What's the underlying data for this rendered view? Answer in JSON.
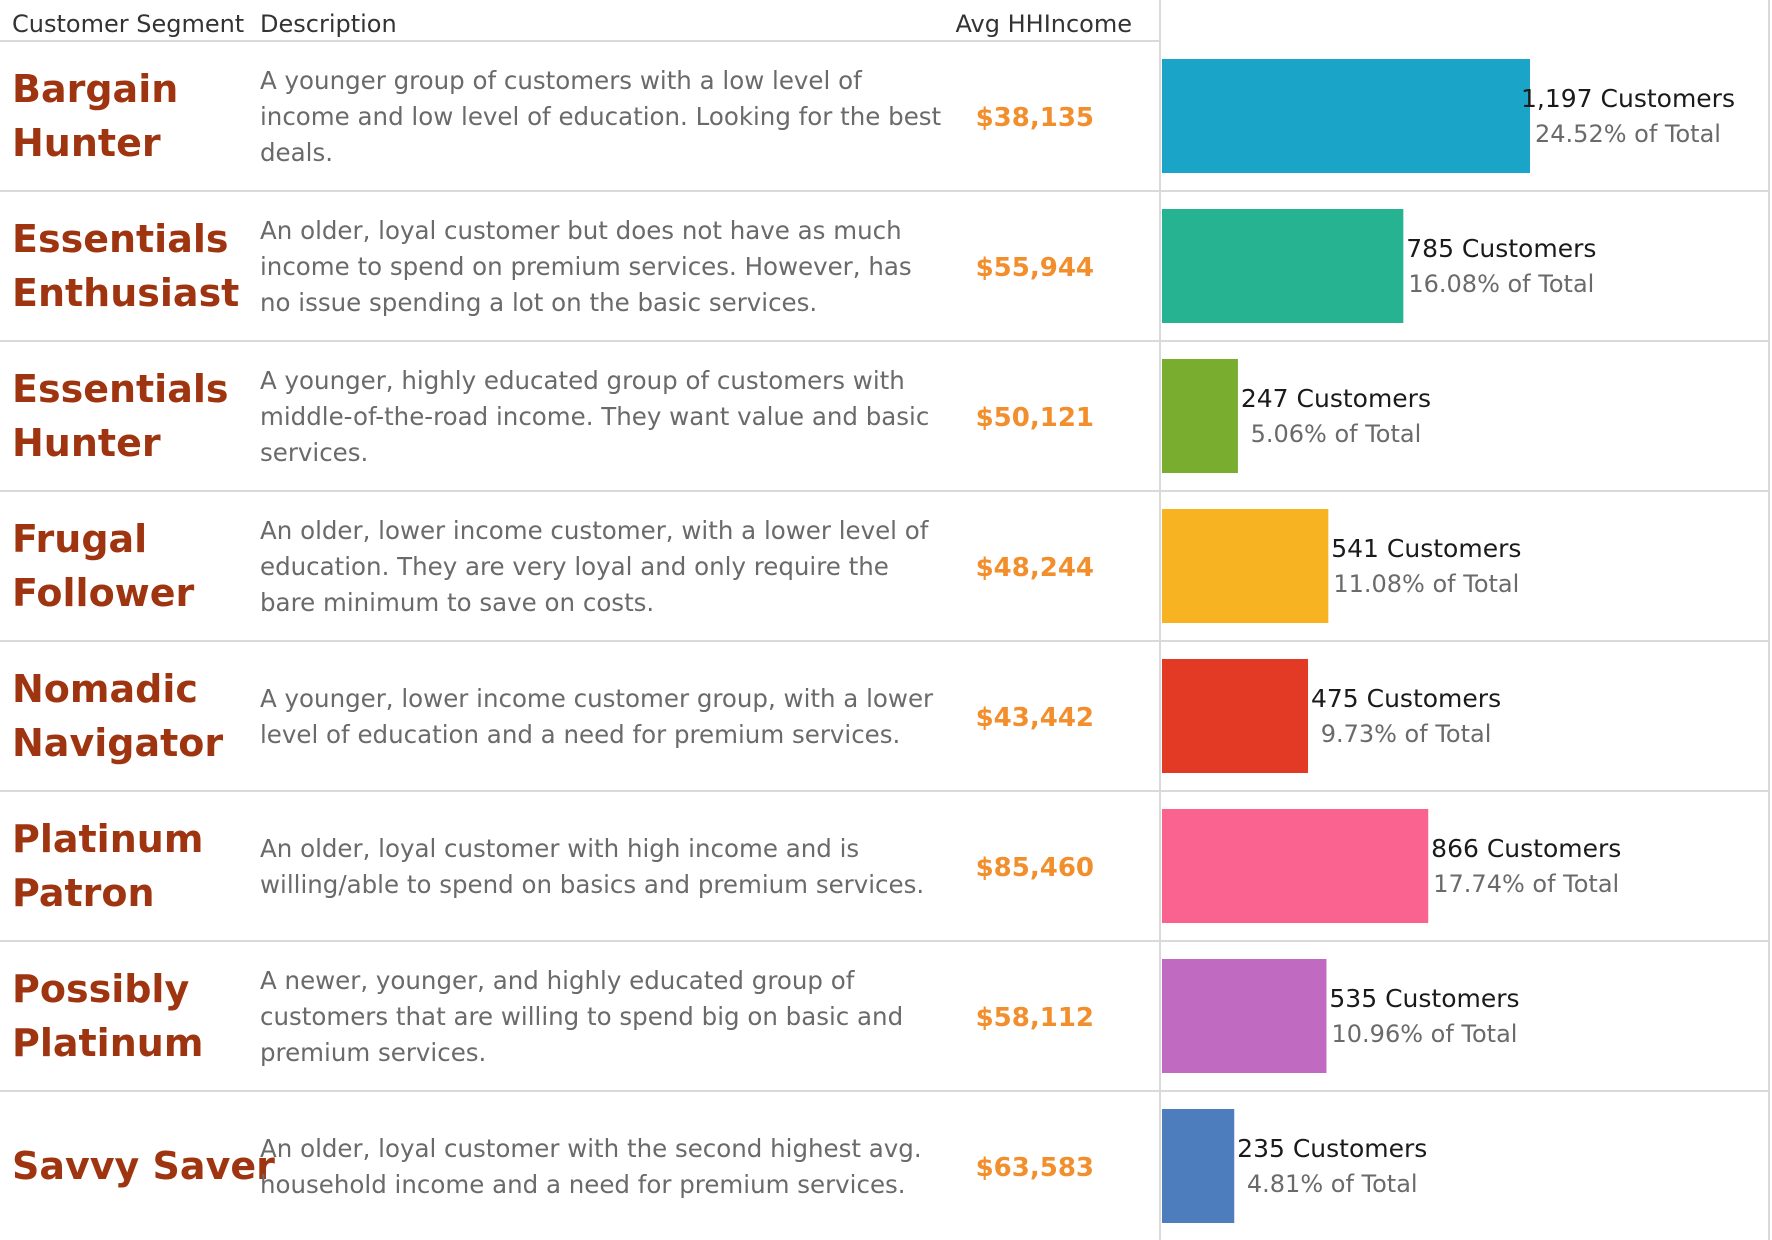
{
  "header": {
    "segment": "Customer Segment",
    "description": "Description",
    "income": "Avg HHIncome"
  },
  "count_suffix": " Customers",
  "pct_suffix": " of Total",
  "chart_data": {
    "type": "bar",
    "orientation": "horizontal",
    "categories": [
      "Bargain Hunter",
      "Essentials Enthusiast",
      "Essentials Hunter",
      "Frugal Follower",
      "Nomadic Navigator",
      "Platinum Patron",
      "Possibly Platinum",
      "Savvy Saver"
    ],
    "values": [
      1197,
      785,
      247,
      541,
      475,
      866,
      535,
      235
    ],
    "grid": false,
    "legend": "none"
  },
  "rows": [
    {
      "segment": [
        "Bargain",
        "Hunter"
      ],
      "description": [
        "A younger group of customers with a low level of",
        "income and low level of education. Looking for the best",
        "deals."
      ],
      "income": "$38,135",
      "count": 1197,
      "count_label": "1,197",
      "pct": "24.52%",
      "color": "#1aa5c8"
    },
    {
      "segment": [
        "Essentials",
        "Enthusiast"
      ],
      "description": [
        "An older, loyal customer but does not have as much",
        "income to spend on premium services. However, has",
        "no issue spending a lot on the basic services."
      ],
      "income": "$55,944",
      "count": 785,
      "count_label": "785",
      "pct": "16.08%",
      "color": "#26b391"
    },
    {
      "segment": [
        "Essentials",
        "Hunter"
      ],
      "description": [
        "A younger, highly educated group of customers with",
        "middle-of-the-road income. They want value and basic",
        "services."
      ],
      "income": "$50,121",
      "count": 247,
      "count_label": "247",
      "pct": "5.06%",
      "color": "#78ad2f"
    },
    {
      "segment": [
        "Frugal",
        "Follower"
      ],
      "description": [
        "An older, lower income customer, with a lower level of",
        "education. They are very loyal and only require the",
        "bare minimum to save on costs."
      ],
      "income": "$48,244",
      "count": 541,
      "count_label": "541",
      "pct": "11.08%",
      "color": "#f7b322"
    },
    {
      "segment": [
        "Nomadic",
        "Navigator"
      ],
      "description": [
        "A younger, lower income customer group, with a lower",
        "level of education and a need for premium services."
      ],
      "income": "$43,442",
      "count": 475,
      "count_label": "475",
      "pct": "9.73%",
      "color": "#e23a25"
    },
    {
      "segment": [
        "Platinum",
        "Patron"
      ],
      "description": [
        "An older, loyal customer with high income and is",
        "willing/able to spend on basics and premium services."
      ],
      "income": "$85,460",
      "count": 866,
      "count_label": "866",
      "pct": "17.74%",
      "color": "#fa6290"
    },
    {
      "segment": [
        "Possibly",
        "Platinum"
      ],
      "description": [
        "A newer, younger, and highly educated group of",
        "customers that are willing to spend big on basic and",
        "premium services."
      ],
      "income": "$58,112",
      "count": 535,
      "count_label": "535",
      "pct": "10.96%",
      "color": "#c06bc1"
    },
    {
      "segment": [
        "Savvy Saver"
      ],
      "description": [
        "An older, loyal customer with the second highest avg.",
        "household income and a need for premium services."
      ],
      "income": "$63,583",
      "count": 235,
      "count_label": "235",
      "pct": "4.81%",
      "color": "#4e7dbd"
    }
  ]
}
